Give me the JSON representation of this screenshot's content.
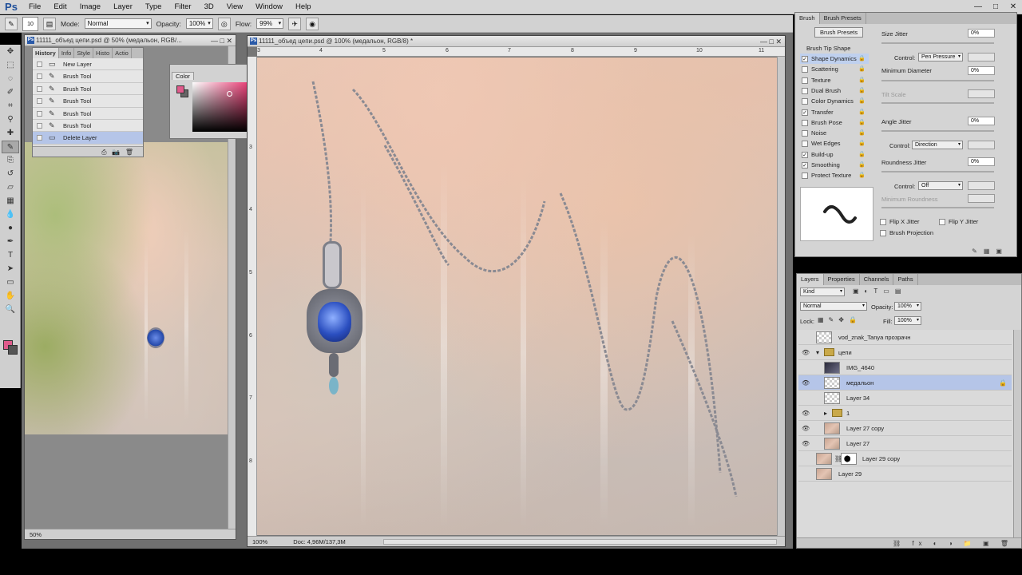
{
  "app": {
    "logo": "Ps",
    "menus": [
      "File",
      "Edit",
      "Image",
      "Layer",
      "Type",
      "Filter",
      "3D",
      "View",
      "Window",
      "Help"
    ],
    "window_controls": [
      "—",
      "□",
      "✕"
    ]
  },
  "options_bar": {
    "brush_size": "10",
    "mode_label": "Mode:",
    "mode_value": "Normal",
    "opacity_label": "Opacity:",
    "opacity_value": "100%",
    "flow_label": "Flow:",
    "flow_value": "99%"
  },
  "tools": [
    "move-tool",
    "marquee-tool",
    "lasso-tool",
    "quick-select-tool",
    "crop-tool",
    "eyedropper-tool",
    "healing-tool",
    "brush-tool",
    "clone-tool",
    "history-brush-tool",
    "eraser-tool",
    "gradient-tool",
    "blur-tool",
    "dodge-tool",
    "pen-tool",
    "type-tool",
    "path-select-tool",
    "shape-tool",
    "hand-tool",
    "zoom-tool"
  ],
  "colors": {
    "foreground": "#e05b8c",
    "background": "#555555",
    "accent": "#b5c5e8"
  },
  "doc1": {
    "title": "11111_объед цепи.psd @ 50% (медальон, RGB/...",
    "zoom": "50%"
  },
  "doc2": {
    "title": "11111_объед цепи.psd @ 100% (медальон, RGB/8) *",
    "zoom": "100%",
    "doc_info": "Doc: 4,96M/137,3M",
    "ruler_top": [
      "3",
      "4",
      "5",
      "6",
      "7",
      "8",
      "9",
      "10",
      "11"
    ],
    "ruler_left": [
      "3",
      "4",
      "5",
      "6",
      "7",
      "8"
    ]
  },
  "history": {
    "tabs": [
      "History",
      "Info",
      "Style",
      "Histo",
      "Actio"
    ],
    "items": [
      {
        "label": "New Layer",
        "icon": "layer-icon"
      },
      {
        "label": "Brush Tool",
        "icon": "brush-icon"
      },
      {
        "label": "Brush Tool",
        "icon": "brush-icon"
      },
      {
        "label": "Brush Tool",
        "icon": "brush-icon"
      },
      {
        "label": "Brush Tool",
        "icon": "brush-icon"
      },
      {
        "label": "Brush Tool",
        "icon": "brush-icon"
      },
      {
        "label": "Delete Layer",
        "icon": "layer-icon"
      }
    ],
    "active_index": 6
  },
  "color_panel": {
    "tab": "Color"
  },
  "brush_panel": {
    "tabs": [
      "Brush",
      "Brush Presets"
    ],
    "presets_button": "Brush Presets",
    "tip_shape": "Brush Tip Shape",
    "options": [
      {
        "label": "Shape Dynamics",
        "checked": "✓"
      },
      {
        "label": "Scattering",
        "checked": ""
      },
      {
        "label": "Texture",
        "checked": ""
      },
      {
        "label": "Dual Brush",
        "checked": ""
      },
      {
        "label": "Color Dynamics",
        "checked": ""
      },
      {
        "label": "Transfer",
        "checked": "✓"
      },
      {
        "label": "Brush Pose",
        "checked": ""
      },
      {
        "label": "Noise",
        "checked": ""
      },
      {
        "label": "Wet Edges",
        "checked": ""
      },
      {
        "label": "Build-up",
        "checked": "✓"
      },
      {
        "label": "Smoothing",
        "checked": "✓"
      },
      {
        "label": "Protect Texture",
        "checked": ""
      }
    ],
    "size_jitter_label": "Size Jitter",
    "size_jitter_value": "0%",
    "control_label": "Control:",
    "control1_value": "Pen Pressure",
    "min_diameter_label": "Minimum Diameter",
    "min_diameter_value": "0%",
    "tilt_scale_label": "Tilt Scale",
    "angle_jitter_label": "Angle Jitter",
    "angle_jitter_value": "0%",
    "control2_value": "Direction",
    "roundness_jitter_label": "Roundness Jitter",
    "roundness_jitter_value": "0%",
    "control3_value": "Off",
    "min_roundness_label": "Minimum Roundness",
    "flip_x_label": "Flip X Jitter",
    "flip_y_label": "Flip Y Jitter",
    "brush_projection_label": "Brush Projection"
  },
  "layers_panel": {
    "tabs": [
      "Layers",
      "Properties",
      "Channels",
      "Paths"
    ],
    "kind_label": "Kind",
    "blend_mode": "Normal",
    "opacity_label": "Opacity:",
    "opacity_value": "100%",
    "lock_label": "Lock:",
    "fill_label": "Fill:",
    "fill_value": "100%",
    "layers": [
      {
        "name": "vod_znak_Tanya прозрачн",
        "visible": "",
        "thumb": "trans",
        "indent": 0,
        "folder": false
      },
      {
        "name": "цепи",
        "visible": "👁",
        "thumb": "",
        "indent": 0,
        "folder": true,
        "arrow": "▾"
      },
      {
        "name": "IMG_4640",
        "visible": "",
        "thumb": "dark",
        "indent": 1,
        "folder": false
      },
      {
        "name": "медальон",
        "visible": "👁",
        "thumb": "trans",
        "indent": 1,
        "folder": false,
        "selected": true,
        "lock": "🔒"
      },
      {
        "name": "Layer 34",
        "visible": "",
        "thumb": "trans",
        "indent": 1,
        "folder": false
      },
      {
        "name": "1",
        "visible": "👁",
        "thumb": "",
        "indent": 1,
        "folder": true,
        "arrow": "▸"
      },
      {
        "name": "Layer 27 copy",
        "visible": "👁",
        "thumb": "photo",
        "indent": 1,
        "folder": false
      },
      {
        "name": "Layer 27",
        "visible": "👁",
        "thumb": "photo",
        "indent": 1,
        "folder": false
      },
      {
        "name": "Layer 29 copy",
        "visible": "",
        "thumb": "photo-mask",
        "indent": 0,
        "folder": false
      },
      {
        "name": "Layer 29",
        "visible": "",
        "thumb": "photo",
        "indent": 0,
        "folder": false
      }
    ],
    "footer_icons": "⛓ fx ◐ ◑ 📁 ▣ 🗑"
  }
}
